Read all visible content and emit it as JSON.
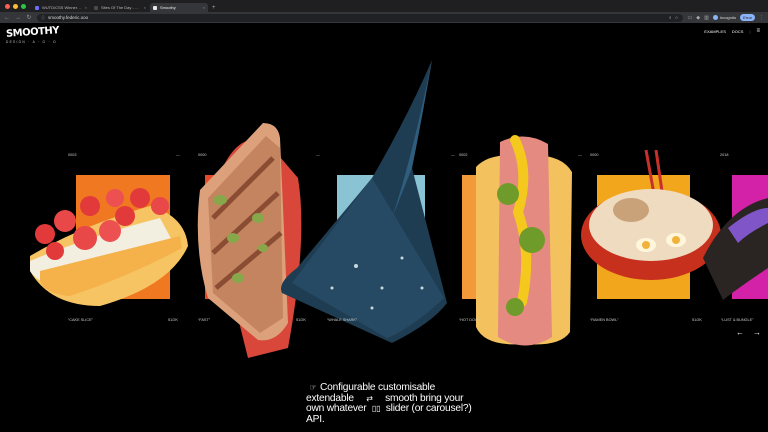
{
  "browser": {
    "tabs": [
      {
        "title": "WUTD/CSS Winners Shown | ...",
        "active": false,
        "color": "#6c6cff"
      },
      {
        "title": "Sites Of The Day - Awwwards",
        "active": false,
        "color": "#4a4a4a"
      },
      {
        "title": "Smoothy",
        "active": true,
        "color": "#e6e6e6"
      }
    ],
    "new_tab": "+",
    "back": "←",
    "forward": "→",
    "reload": "↻",
    "url": "smoothy.federic.ooo",
    "incognito_label": "Incognito",
    "error_label": "Error"
  },
  "site": {
    "logo": "SMOOTHY",
    "logo_sub": "DESIGN · A · G · O",
    "nav": {
      "examples": "EXAMPLES",
      "docs": "DOCS",
      "separator": "|",
      "menu": "≡"
    }
  },
  "slider": {
    "years": [
      "0003",
      "—",
      "0000",
      "—",
      "0002",
      "—",
      "0000",
      "—",
      "2018"
    ],
    "names": [
      "“CAKE SLICE”",
      "51/2K",
      "“FAST”",
      "51/2K",
      "“WHALE SHARK”",
      "“HOT DOG”",
      "“RAMEN BOWL”",
      "51/2K",
      "“LUST & BUNGLE”"
    ],
    "prev": "←",
    "next": "→",
    "cards": [
      {
        "item": "cake",
        "bg": "#f07821"
      },
      {
        "item": "sandwich",
        "bg": "#e64a28"
      },
      {
        "item": "whale-shark",
        "bg": "#8ac4d4"
      },
      {
        "item": "hotdog",
        "bg": "#f29a3a"
      },
      {
        "item": "ramen",
        "bg": "#f2a61c"
      },
      {
        "item": "lust",
        "bg": "#d422a8"
      }
    ]
  },
  "tagline": {
    "line1": "Configurable customisable",
    "line2a": "extendable",
    "line2b": "smooth bring your",
    "line3a": "own whatever",
    "line3b": "slider (or carousel?)",
    "line4": "API."
  }
}
